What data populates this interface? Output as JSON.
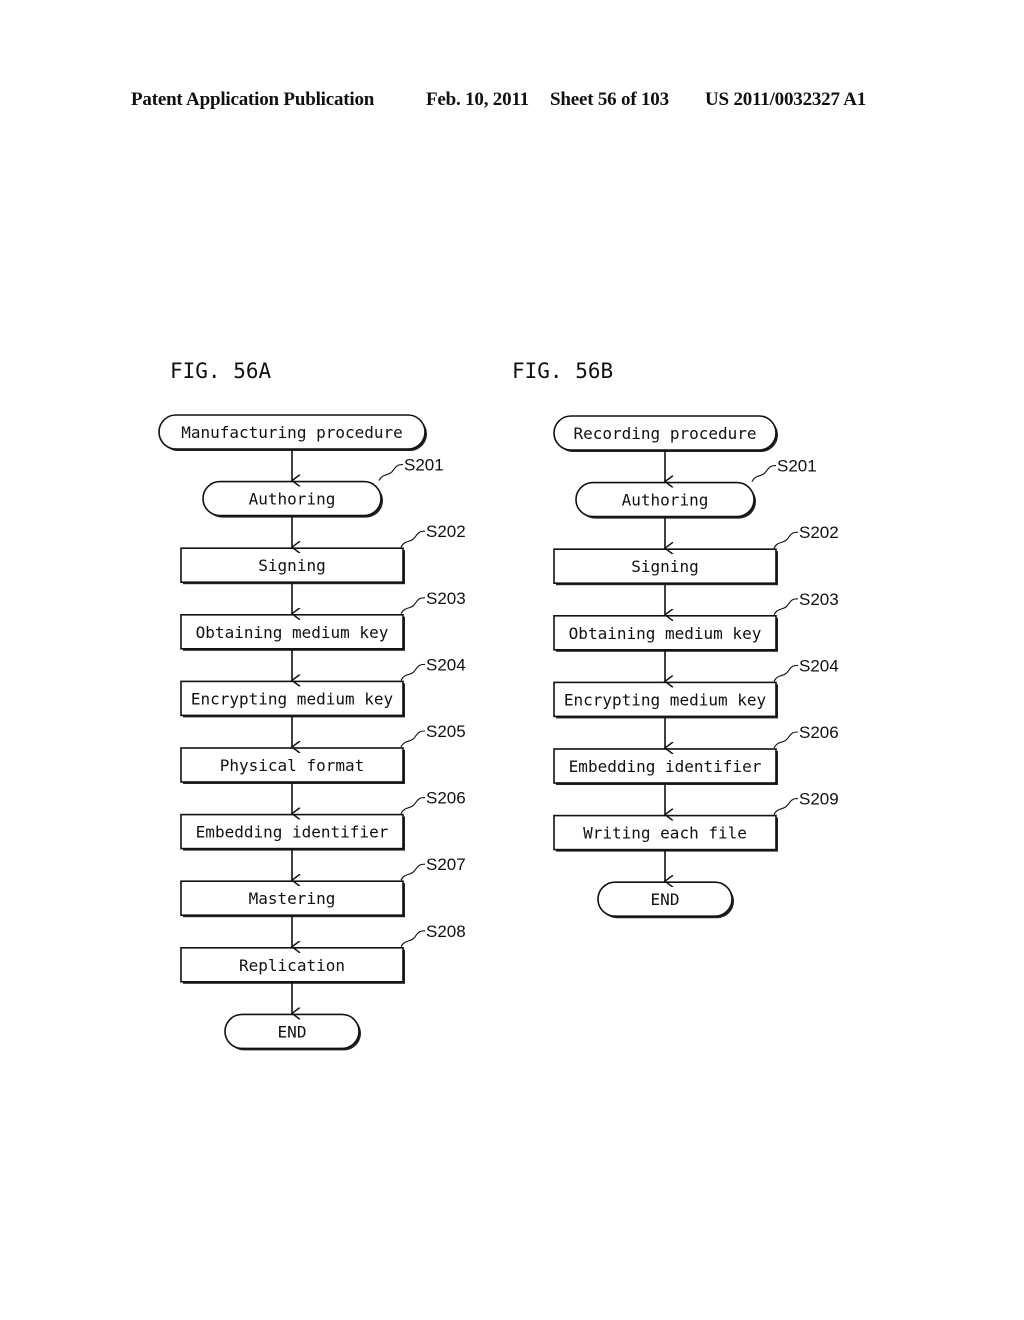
{
  "header": {
    "publication": "Patent Application Publication",
    "date": "Feb. 10, 2011",
    "sheet": "Sheet 56 of 103",
    "number": "US 2011/0032327 A1"
  },
  "figures": [
    {
      "id": "56A",
      "title": "FIG. 56A",
      "nodes": [
        {
          "type": "terminal",
          "label": "Manufacturing procedure",
          "step": ""
        },
        {
          "type": "terminal",
          "label": "Authoring",
          "step": "S201"
        },
        {
          "type": "process",
          "label": "Signing",
          "step": "S202"
        },
        {
          "type": "process",
          "label": "Obtaining medium key",
          "step": "S203"
        },
        {
          "type": "process",
          "label": "Encrypting medium key",
          "step": "S204"
        },
        {
          "type": "process",
          "label": "Physical format",
          "step": "S205"
        },
        {
          "type": "process",
          "label": "Embedding identifier",
          "step": "S206"
        },
        {
          "type": "process",
          "label": "Mastering",
          "step": "S207"
        },
        {
          "type": "process",
          "label": "Replication",
          "step": "S208"
        },
        {
          "type": "end",
          "label": "END",
          "step": ""
        }
      ]
    },
    {
      "id": "56B",
      "title": "FIG. 56B",
      "nodes": [
        {
          "type": "terminal",
          "label": "Recording procedure",
          "step": ""
        },
        {
          "type": "terminal",
          "label": "Authoring",
          "step": "S201"
        },
        {
          "type": "process",
          "label": "Signing",
          "step": "S202"
        },
        {
          "type": "process",
          "label": "Obtaining medium key",
          "step": "S203"
        },
        {
          "type": "process",
          "label": "Encrypting medium key",
          "step": "S204"
        },
        {
          "type": "process",
          "label": "Embedding identifier",
          "step": "S206"
        },
        {
          "type": "process",
          "label": "Writing each file",
          "step": "S209"
        },
        {
          "type": "end",
          "label": "END",
          "step": ""
        }
      ]
    }
  ]
}
